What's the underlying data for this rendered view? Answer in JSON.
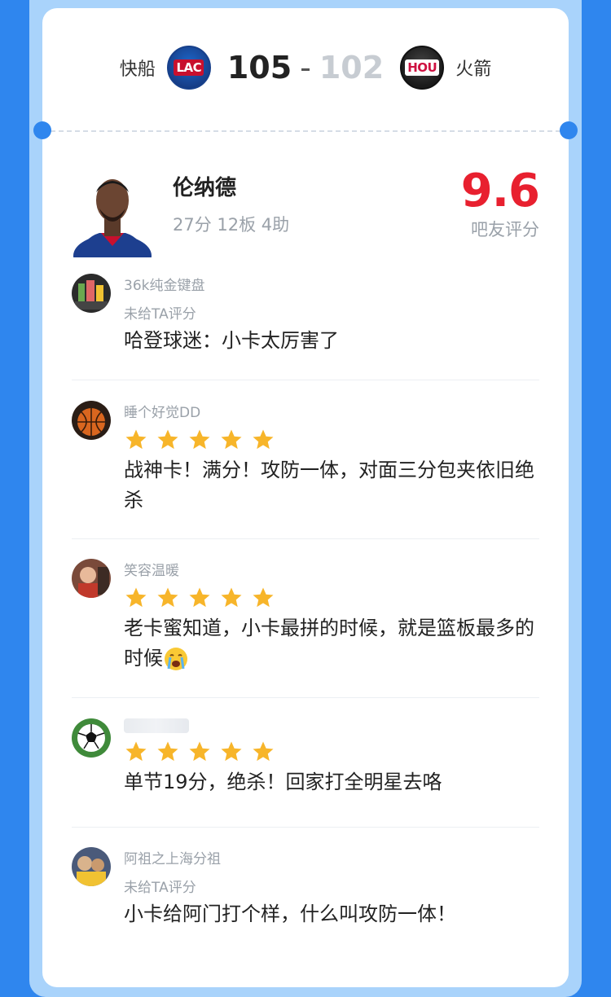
{
  "match": {
    "home_team": "快船",
    "home_abbr": "LAC",
    "home_score": "105",
    "separator": "-",
    "away_score": "102",
    "away_abbr": "HOU",
    "away_team": "火箭"
  },
  "player": {
    "name": "伦纳德",
    "stats": "27分 12板 4助",
    "rating": "9.6",
    "rating_label": "吧友评分"
  },
  "comments": [
    {
      "user": "36k纯金键盘",
      "rated": false,
      "status": "未给TA评分",
      "text": "哈登球迷：小卡太厉害了"
    },
    {
      "user": "睡个好觉DD",
      "rated": true,
      "stars": 5,
      "text": "战神卡！满分！攻防一体，对面三分包夹依旧绝杀"
    },
    {
      "user": "笑容温暖",
      "rated": true,
      "stars": 5,
      "text": "老卡蜜知道，小卡最拼的时候，就是篮板最多的时候"
    },
    {
      "user": "",
      "rated": true,
      "stars": 5,
      "text": "单节19分，绝杀！回家打全明星去咯"
    },
    {
      "user": "阿祖之上海分祖",
      "rated": false,
      "status": "未给TA评分",
      "text": "小卡给阿门打个样，什么叫攻防一体！"
    }
  ],
  "colors": {
    "accent_red": "#e8202f",
    "star_gold": "#f7b52a",
    "background_blue": "#2f86ee"
  }
}
